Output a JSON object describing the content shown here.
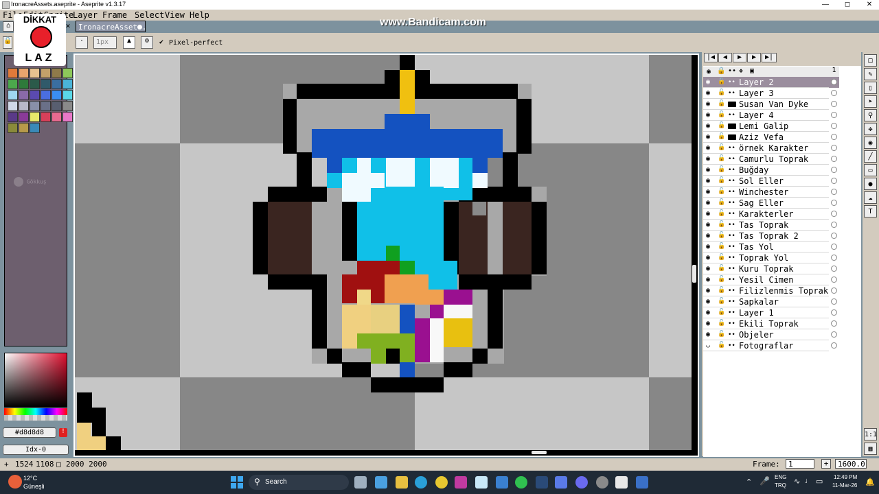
{
  "window": {
    "title": "IronacreAssets.aseprite - Aseprite v1.3.17"
  },
  "menu": [
    "File",
    "Edit",
    "Sprite",
    "Layer",
    "Frame",
    "Select",
    "View",
    "Help"
  ],
  "tab": {
    "label": "IronacreAssets."
  },
  "context_bar": {
    "size_value": "1px",
    "pixel_perfect_label": "Pixel-perfect"
  },
  "watermark": "www.Bandicam.com",
  "logo": {
    "line1": "DİKKAT",
    "line2": "LAZ"
  },
  "left_panel": {
    "hex_value": "#d8d8d8",
    "index_value": "Idx-0",
    "overlay_label": "Gökkuş"
  },
  "palette_colors": [
    "#e07a3a",
    "#e9a56d",
    "#e8c18f",
    "#c4a06a",
    "#8e7a4a",
    "#8dc85a",
    "#4ca84c",
    "#2e7a3a",
    "#2b5a4a",
    "#305a6a",
    "#3a6ea0",
    "#4ab4d8",
    "#9fd8f0",
    "#8a6aa8",
    "#5a4ab0",
    "#4a6ee0",
    "#3a8ef0",
    "#5ad8e8",
    "#d0d8e8",
    "#b8b8c8",
    "#8890a8",
    "#6a7088",
    "#585e70",
    "#8a8a8a",
    "#5a3a88",
    "#8a3a98",
    "#e8e86a",
    "#d8405a",
    "#e86a90",
    "#e878c8",
    "#8a8a3a",
    "#b89a4a",
    "#3a8ab8"
  ],
  "layers_panel": {
    "frame_number": "1",
    "layers": [
      {
        "name": "Layer 2",
        "type": "layer",
        "selected": true
      },
      {
        "name": "Layer 3",
        "type": "layer"
      },
      {
        "name": "Susan Van Dyke",
        "type": "group"
      },
      {
        "name": "Layer 4",
        "type": "layer"
      },
      {
        "name": "Lemi Galip",
        "type": "group"
      },
      {
        "name": "Aziz Vefa",
        "type": "group"
      },
      {
        "name": "örnek Karakter",
        "type": "layer"
      },
      {
        "name": "Camurlu Toprak",
        "type": "layer"
      },
      {
        "name": "Buğday",
        "type": "layer"
      },
      {
        "name": "Sol Eller",
        "type": "layer"
      },
      {
        "name": "Winchester",
        "type": "layer"
      },
      {
        "name": "Sag Eller",
        "type": "layer"
      },
      {
        "name": "Karakterler",
        "type": "layer"
      },
      {
        "name": "Tas Toprak",
        "type": "layer"
      },
      {
        "name": "Tas Toprak 2",
        "type": "layer"
      },
      {
        "name": "Tas Yol",
        "type": "layer"
      },
      {
        "name": "Toprak Yol",
        "type": "layer"
      },
      {
        "name": "Kuru Toprak",
        "type": "layer"
      },
      {
        "name": "Yesil Cimen",
        "type": "layer"
      },
      {
        "name": "Filizlenmis Toprak",
        "type": "layer"
      },
      {
        "name": "Sapkalar",
        "type": "layer"
      },
      {
        "name": "Layer 1",
        "type": "layer"
      },
      {
        "name": "Ekili Toprak",
        "type": "layer"
      },
      {
        "name": "Objeler",
        "type": "layer"
      },
      {
        "name": "Fotograflar",
        "type": "layer"
      }
    ]
  },
  "status_bar": {
    "cursor_x": "1524",
    "cursor_y": "1108",
    "sprite_size": "2000 2000",
    "frame_label": "Frame:",
    "frame_value": "1",
    "zoom_value": "1600.0"
  },
  "taskbar": {
    "weather_temp": "12°C",
    "weather_location": "Güneşli",
    "search_label": "Search",
    "lang_1": "ENG",
    "lang_2": "TRQ",
    "time": "12:49 PM",
    "date": "11-Mar-26"
  },
  "colors": {
    "ui_bg": "#d3cbbe",
    "workspace": "#7d929e",
    "selection": "#9b8e9e"
  }
}
